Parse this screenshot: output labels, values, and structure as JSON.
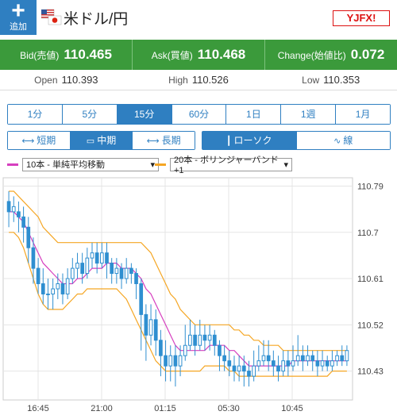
{
  "header": {
    "add_label": "追加",
    "pair_name": "米ドル/円",
    "logo_text": "YJFX!"
  },
  "quotes": {
    "bid_label": "Bid(売値)",
    "bid_value": "110.465",
    "ask_label": "Ask(買値)",
    "ask_value": "110.468",
    "change_label": "Change(始値比)",
    "change_value": "0.072"
  },
  "ohl": {
    "open_label": "Open",
    "open_value": "110.393",
    "high_label": "High",
    "high_value": "110.526",
    "low_label": "Low",
    "low_value": "110.353"
  },
  "timeframes": [
    "1分",
    "5分",
    "15分",
    "60分",
    "1日",
    "1週",
    "1月"
  ],
  "timeframe_selected": "15分",
  "ranges": [
    "短期",
    "中期",
    "長期"
  ],
  "range_selected": "中期",
  "chart_types": [
    "ローソク",
    "線"
  ],
  "chart_type_selected": "ローソク",
  "indicators": {
    "ma_label": "10本 - 単純平均移動",
    "ma_color": "#d63fbf",
    "bb_label": "20本 - ボリンジャーバンド+1",
    "bb_color": "#f5a623"
  },
  "colors": {
    "candle": "#2f8fd0",
    "accent": "#2f7fc1",
    "quote_bar": "#3b9a3b"
  },
  "chart_data": {
    "type": "candlestick",
    "y_ticks": [
      "110.79",
      "110.7",
      "110.61",
      "110.52",
      "110.43"
    ],
    "x_ticks": [
      "16:45",
      "21:00",
      "01:15",
      "05:30",
      "10:45"
    ],
    "ylim": [
      110.38,
      110.8
    ],
    "grid": true,
    "candles": [
      [
        110.76,
        110.74,
        110.78,
        110.71
      ],
      [
        110.74,
        110.75,
        110.77,
        110.72
      ],
      [
        110.74,
        110.73,
        110.76,
        110.7
      ],
      [
        110.73,
        110.71,
        110.75,
        110.68
      ],
      [
        110.71,
        110.67,
        110.73,
        110.64
      ],
      [
        110.67,
        110.63,
        110.69,
        110.6
      ],
      [
        110.63,
        110.6,
        110.65,
        110.58
      ],
      [
        110.6,
        110.58,
        110.63,
        110.56
      ],
      [
        110.58,
        110.58,
        110.61,
        110.55
      ],
      [
        110.58,
        110.59,
        110.61,
        110.55
      ],
      [
        110.59,
        110.6,
        110.62,
        110.57
      ],
      [
        110.6,
        110.58,
        110.62,
        110.56
      ],
      [
        110.58,
        110.61,
        110.63,
        110.57
      ],
      [
        110.61,
        110.63,
        110.65,
        110.6
      ],
      [
        110.63,
        110.64,
        110.66,
        110.61
      ],
      [
        110.64,
        110.62,
        110.66,
        110.6
      ],
      [
        110.62,
        110.65,
        110.67,
        110.61
      ],
      [
        110.65,
        110.66,
        110.68,
        110.63
      ],
      [
        110.66,
        110.64,
        110.68,
        110.62
      ],
      [
        110.64,
        110.66,
        110.68,
        110.63
      ],
      [
        110.66,
        110.64,
        110.68,
        110.61
      ],
      [
        110.64,
        110.62,
        110.65,
        110.6
      ],
      [
        110.62,
        110.63,
        110.65,
        110.6
      ],
      [
        110.63,
        110.61,
        110.64,
        110.59
      ],
      [
        110.61,
        110.63,
        110.65,
        110.6
      ],
      [
        110.63,
        110.62,
        110.64,
        110.6
      ],
      [
        110.62,
        110.6,
        110.63,
        110.57
      ],
      [
        110.6,
        110.54,
        110.61,
        110.47
      ],
      [
        110.54,
        110.5,
        110.56,
        110.45
      ],
      [
        110.5,
        110.53,
        110.56,
        110.48
      ],
      [
        110.53,
        110.49,
        110.55,
        110.46
      ],
      [
        110.49,
        110.46,
        110.51,
        110.42
      ],
      [
        110.46,
        110.44,
        110.49,
        110.41
      ],
      [
        110.44,
        110.46,
        110.48,
        110.41
      ],
      [
        110.46,
        110.44,
        110.48,
        110.4
      ],
      [
        110.44,
        110.46,
        110.48,
        110.42
      ],
      [
        110.46,
        110.48,
        110.52,
        110.45
      ],
      [
        110.48,
        110.5,
        110.53,
        110.47
      ],
      [
        110.5,
        110.48,
        110.52,
        110.46
      ],
      [
        110.48,
        110.5,
        110.53,
        110.47
      ],
      [
        110.5,
        110.49,
        110.52,
        110.47
      ],
      [
        110.49,
        110.5,
        110.52,
        110.47
      ],
      [
        110.5,
        110.48,
        110.51,
        110.46
      ],
      [
        110.48,
        110.46,
        110.49,
        110.43
      ],
      [
        110.46,
        110.45,
        110.48,
        110.43
      ],
      [
        110.45,
        110.44,
        110.47,
        110.42
      ],
      [
        110.44,
        110.43,
        110.46,
        110.41
      ],
      [
        110.43,
        110.44,
        110.46,
        110.41
      ],
      [
        110.44,
        110.43,
        110.46,
        110.4
      ],
      [
        110.43,
        110.42,
        110.45,
        110.4
      ],
      [
        110.42,
        110.44,
        110.47,
        110.41
      ],
      [
        110.44,
        110.45,
        110.48,
        110.43
      ],
      [
        110.45,
        110.46,
        110.49,
        110.44
      ],
      [
        110.46,
        110.45,
        110.49,
        110.43
      ],
      [
        110.45,
        110.44,
        110.47,
        110.42
      ],
      [
        110.44,
        110.43,
        110.46,
        110.41
      ],
      [
        110.43,
        110.45,
        110.47,
        110.42
      ],
      [
        110.45,
        110.44,
        110.47,
        110.42
      ],
      [
        110.44,
        110.45,
        110.48,
        110.43
      ],
      [
        110.45,
        110.46,
        110.5,
        110.44
      ],
      [
        110.46,
        110.45,
        110.48,
        110.43
      ],
      [
        110.45,
        110.46,
        110.48,
        110.44
      ],
      [
        110.46,
        110.45,
        110.47,
        110.43
      ],
      [
        110.45,
        110.44,
        110.47,
        110.42
      ],
      [
        110.44,
        110.45,
        110.47,
        110.43
      ],
      [
        110.45,
        110.44,
        110.46,
        110.43
      ],
      [
        110.44,
        110.45,
        110.47,
        110.43
      ],
      [
        110.45,
        110.46,
        110.47,
        110.44
      ],
      [
        110.46,
        110.45,
        110.48,
        110.44
      ],
      [
        110.45,
        110.47,
        110.48,
        110.44
      ]
    ],
    "ma": [
      110.74,
      110.74,
      110.73,
      110.72,
      110.7,
      110.68,
      110.66,
      110.64,
      110.63,
      110.62,
      110.61,
      110.6,
      110.6,
      110.6,
      110.61,
      110.61,
      110.62,
      110.63,
      110.63,
      110.63,
      110.64,
      110.64,
      110.64,
      110.63,
      110.63,
      110.63,
      110.62,
      110.61,
      110.59,
      110.58,
      110.56,
      110.54,
      110.52,
      110.5,
      110.48,
      110.47,
      110.47,
      110.47,
      110.47,
      110.47,
      110.47,
      110.48,
      110.48,
      110.48,
      110.48,
      110.47,
      110.47,
      110.46,
      110.45,
      110.44,
      110.44,
      110.44,
      110.44,
      110.44,
      110.44,
      110.44,
      110.44,
      110.44,
      110.45,
      110.45,
      110.45,
      110.45,
      110.45,
      110.45,
      110.45,
      110.45,
      110.45,
      110.45,
      110.45,
      110.45
    ],
    "bb_upper": [
      110.78,
      110.78,
      110.77,
      110.76,
      110.75,
      110.74,
      110.73,
      110.71,
      110.7,
      110.69,
      110.68,
      110.68,
      110.68,
      110.68,
      110.68,
      110.68,
      110.68,
      110.68,
      110.68,
      110.68,
      110.68,
      110.68,
      110.68,
      110.68,
      110.68,
      110.68,
      110.68,
      110.68,
      110.67,
      110.66,
      110.64,
      110.62,
      110.6,
      110.58,
      110.57,
      110.55,
      110.54,
      110.53,
      110.52,
      110.52,
      110.52,
      110.52,
      110.52,
      110.52,
      110.52,
      110.52,
      110.51,
      110.51,
      110.5,
      110.5,
      110.49,
      110.49,
      110.48,
      110.48,
      110.48,
      110.48,
      110.47,
      110.47,
      110.47,
      110.47,
      110.47,
      110.47,
      110.47,
      110.47,
      110.47,
      110.47,
      110.47,
      110.47,
      110.47,
      110.47
    ],
    "bb_lower": [
      110.7,
      110.7,
      110.69,
      110.67,
      110.64,
      110.61,
      110.58,
      110.56,
      110.55,
      110.55,
      110.55,
      110.55,
      110.56,
      110.57,
      110.58,
      110.58,
      110.59,
      110.59,
      110.59,
      110.59,
      110.59,
      110.59,
      110.59,
      110.58,
      110.57,
      110.55,
      110.53,
      110.51,
      110.49,
      110.47,
      110.45,
      110.44,
      110.43,
      110.43,
      110.43,
      110.43,
      110.43,
      110.43,
      110.43,
      110.43,
      110.44,
      110.44,
      110.44,
      110.44,
      110.44,
      110.43,
      110.43,
      110.42,
      110.42,
      110.42,
      110.42,
      110.42,
      110.42,
      110.42,
      110.42,
      110.42,
      110.42,
      110.42,
      110.42,
      110.42,
      110.42,
      110.42,
      110.42,
      110.42,
      110.42,
      110.42,
      110.43,
      110.43,
      110.43,
      110.43
    ]
  }
}
